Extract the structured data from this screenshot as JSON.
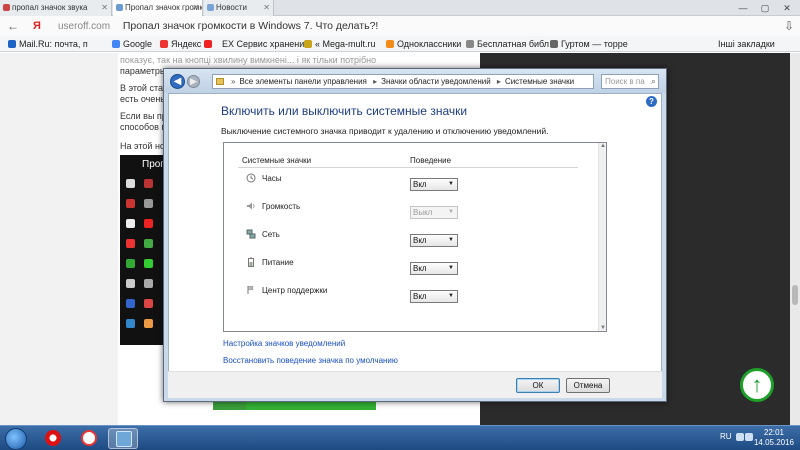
{
  "browser": {
    "tabs": [
      {
        "label": "пропал значок звука"
      },
      {
        "label": "Пропал значок громк"
      },
      {
        "label": "Новости"
      }
    ],
    "address_domain": "useroff.com",
    "page_title": "Пропал значок громкости в Windows 7. Что делать?!",
    "yandex_letter": "Я",
    "bookmarks": [
      {
        "label": "Mail.Ru: почта, п",
        "color": "#1d63c4"
      },
      {
        "label": "Google",
        "color": "#4285f4"
      },
      {
        "label": "Яндекс",
        "color": "#e33"
      },
      {
        "label": "",
        "color": "#e22"
      },
      {
        "label": "EX Сервис хранени",
        "color": "#666"
      },
      {
        "label": "« Mega-mult.ru",
        "color": "#c7a41a"
      },
      {
        "label": "Одноклассники",
        "color": "#f28b1a"
      },
      {
        "label": "Бесплатная библ",
        "color": "#888"
      },
      {
        "label": "Гуртом — торре",
        "color": "#666"
      }
    ],
    "other_bookmarks": "Інші закладки"
  },
  "article": {
    "p0": "показує, так на кнопці хвилину вимкнені... і як тільки потрібно",
    "p1": "параметры",
    "p2": "В этой стат",
    "p3": "есть очень",
    "p4": "Если вы пр",
    "p5": "способов п",
    "p6": "На этой но",
    "thumb_title": "Пропал"
  },
  "window": {
    "breadcrumb": [
      "Все элементы панели управления",
      "Значки области уведомлений",
      "Системные значки"
    ],
    "search_placeholder": "Поиск в па",
    "heading": "Включить или выключить системные значки",
    "description": "Выключение системного значка приводит к удалению и отключению уведомлений.",
    "columns": {
      "name": "Системные значки",
      "behavior": "Поведение"
    },
    "rows": [
      {
        "label": "Часы",
        "value": "Вкл",
        "disabled": false,
        "icon": "clock-icon"
      },
      {
        "label": "Громкость",
        "value": "Выкл",
        "disabled": true,
        "icon": "speaker-icon"
      },
      {
        "label": "Сеть",
        "value": "Вкл",
        "disabled": false,
        "icon": "network-icon"
      },
      {
        "label": "Питание",
        "value": "Вкл",
        "disabled": false,
        "icon": "battery-icon"
      },
      {
        "label": "Центр поддержки",
        "value": "Вкл",
        "disabled": false,
        "icon": "flag-icon"
      }
    ],
    "links": {
      "customize": "Настройка значков уведомлений",
      "restore": "Восстановить поведение значка по умолчанию"
    },
    "buttons": {
      "ok": "ОК",
      "cancel": "Отмена"
    }
  },
  "taskbar": {
    "lang": "RU",
    "time": "22:01",
    "date": "14.05.2016"
  },
  "colors": {
    "link": "#1a4fbf",
    "heading": "#1e3c82",
    "accent_green": "#1e9f2a"
  }
}
